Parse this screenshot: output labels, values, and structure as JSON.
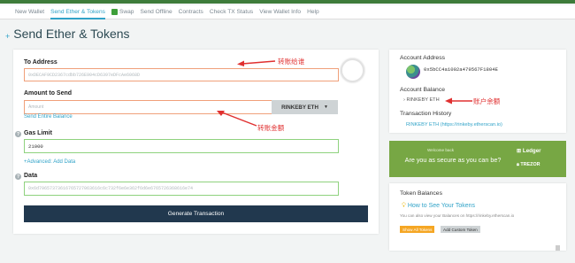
{
  "nav": {
    "items": [
      "New Wallet",
      "Send Ether & Tokens",
      "Swap",
      "Send Offline",
      "Contracts",
      "Check TX Status",
      "View Wallet Info",
      "Help"
    ],
    "active_index": 1
  },
  "page": {
    "title": "Send Ether & Tokens",
    "plus": "+"
  },
  "form": {
    "to_address_label": "To Address",
    "to_address_value": "0xDECAF9CD2367cdbb726E904cD6397eDFcAe6068D",
    "amount_label": "Amount to Send",
    "amount_placeholder": "Amount",
    "send_entire_balance": "Send Entire Balance",
    "currency": "RINKEBY ETH",
    "caret": "▼",
    "gas_limit_label": "Gas Limit",
    "gas_limit_value": "21000",
    "advanced_link": "+Advanced: Add Data",
    "data_label": "Data",
    "data_value": "0x6d79657373616765727063616c6c732f6e6e362f6d6e6765726368616e74",
    "generate_button": "Generate Transaction",
    "info_glyph": "?"
  },
  "annotations": {
    "to_address_note": "转账给谁",
    "amount_note": "转账金额",
    "balance_note": "账户余额"
  },
  "account": {
    "address_label": "Account Address",
    "address_value": "0x5bCC4a1002a479567F1804E",
    "balance_label": "Account Balance",
    "balance_value": "RINKEBY ETH",
    "balance_chevron": "›",
    "tx_history_label": "Transaction History",
    "tx_history_link": "RINKEBY ETH (https://rinkeby.etherscan.io)"
  },
  "ledger": {
    "welcome": "Welcome back",
    "headline": "Are you as secure as you can be?",
    "ledger_brand": "Ledger",
    "trezor_brand": "TREZOR"
  },
  "tokens": {
    "title": "Token Balances",
    "how_to_link": "How to See Your Tokens",
    "subtext": "You can also view your Balances on https://rinkeby.etherscan.io",
    "show_all_button": "Show All Tokens",
    "add_custom_button": "Add Custom Token"
  },
  "colors": {
    "accent": "#31a3c8",
    "primary_button": "#21384e",
    "ledger_green": "#77a744",
    "annotation_red": "#e03030"
  }
}
